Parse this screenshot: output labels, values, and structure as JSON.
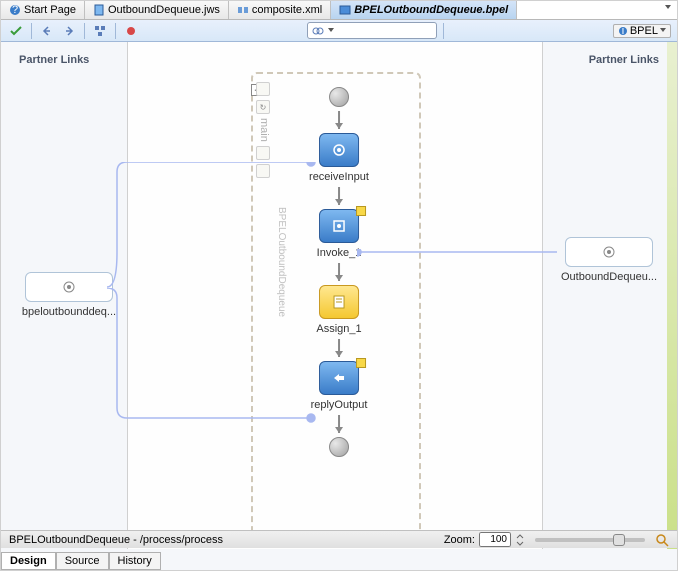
{
  "tabs": [
    {
      "label": "Start Page",
      "icon": "#3a7cc8"
    },
    {
      "label": "OutboundDequeue.jws",
      "icon": "#7eb8f0"
    },
    {
      "label": "composite.xml",
      "icon": "#6a9cd8"
    },
    {
      "label": "BPELOutboundDequeue.bpel",
      "icon": "#4a8cd8",
      "active": true
    }
  ],
  "bpel_label": "BPEL",
  "partner_links_label": "Partner Links",
  "left_partner": {
    "label": "bpeloutbounddeq..."
  },
  "right_partner": {
    "label": "OutboundDequeu..."
  },
  "activities": {
    "receive": "receiveInput",
    "invoke": "Invoke_1",
    "assign": "Assign_1",
    "reply": "replyOutput"
  },
  "vtext": "BPELOutboundDequeue",
  "status": "BPELOutboundDequeue - /process/process",
  "zoom": {
    "label": "Zoom:",
    "value": "100"
  },
  "bottom_tabs": [
    "Design",
    "Source",
    "History"
  ],
  "collapse": "−",
  "main_label": "main"
}
